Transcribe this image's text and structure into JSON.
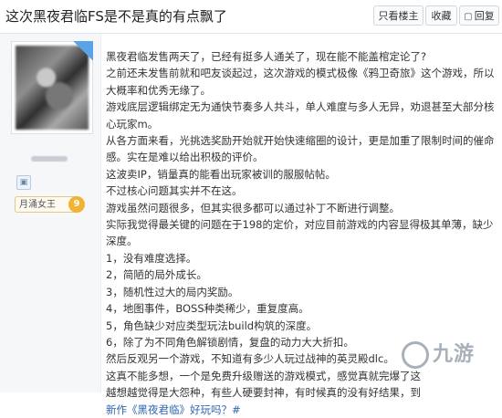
{
  "header": {
    "title": "这次黑夜君临FS是不是真的有点飘了",
    "buttons": {
      "only_author": "只看楼主",
      "favorite": "收藏",
      "reply": "回复"
    }
  },
  "sidebar": {
    "level_name": "月涌女王",
    "level_num": "9"
  },
  "post": {
    "paragraphs": [
      "黑夜君临发售两天了，已经有挺多人通关了，现在能不能盖棺定论了?",
      "之前还未发售前就和吧友谈起过，这次游戏的模式极像《鸦卫奇旅》这个游戏，所以大概率和优秀无缘了。",
      "游戏底层逻辑绑定无为通快节奏多人共斗，单人难度与多人无异，劝退甚至大部分核心玩家m。",
      "从各方面来看，光挑选奖励开始就开始快速缩圈的设计，更是加重了限制时间的催命感。实在是难以给出积极的评价。",
      "这波卖IP，销量真的能看出玩家被训的服服帖帖。",
      "不过核心问题其实并不在这。",
      "游戏虽然问题很多，但其实很多都可以通过补丁不断进行调整。",
      "实际我觉得最关键的问题在于198的定价，对应目前游戏的内容显得极其单薄，缺少深度。",
      "1，没有难度选择。",
      "2，简陋的局外成长。",
      "3，随机性过大的局内奖励。",
      "4，地图事件，BOSS种类稀少，重复度高。",
      "5，角色缺少对应类型玩法build构筑的深度。",
      "6，除了为不同角色解锁剧情，复盘的动力大大折扣。",
      "然后反观另一个游戏，不知道有多少人玩过战神的英灵殿dlc。",
      "这真不能多想，一个是免费升级赠送的游戏模式，感觉真就完爆了这",
      "越想越觉得是大怨种，有些人硬要封神，有时候真的没有好结果，到"
    ],
    "link_text": "新作《黑夜君临》好玩吗？#"
  },
  "watermark": {
    "text": "九游"
  }
}
